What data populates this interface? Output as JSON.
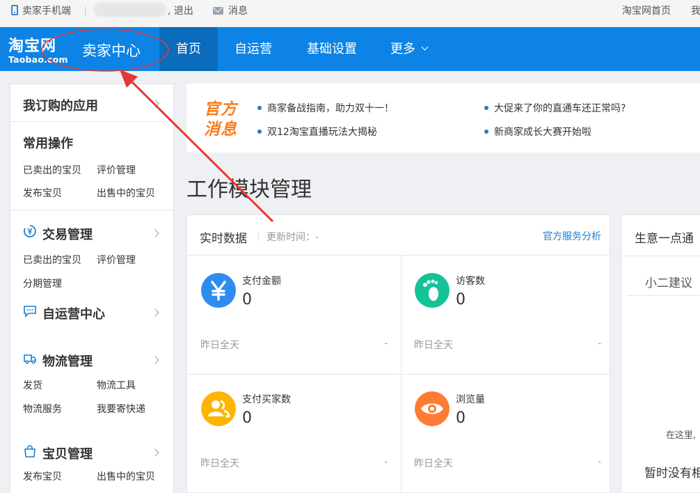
{
  "topbar": {
    "mobile": "卖家手机端",
    "logout": ", 退出",
    "messages": "消息",
    "home": "淘宝网首页",
    "my": "我"
  },
  "nav": {
    "logo_cn": "淘宝网",
    "logo_en": "Taobao.com",
    "seller_center": "卖家中心",
    "tabs": [
      {
        "label": "首页"
      },
      {
        "label": "自运营"
      },
      {
        "label": "基础设置"
      },
      {
        "label": "更多"
      }
    ],
    "brand_color": "#0d84e5"
  },
  "sidebar": {
    "subscribed": "我订购的应用",
    "common": {
      "title": "常用操作",
      "links": [
        "已卖出的宝贝",
        "评价管理",
        "发布宝贝",
        "出售中的宝贝"
      ]
    },
    "trade": {
      "title": "交易管理",
      "links": [
        "已卖出的宝贝",
        "评价管理",
        "分期管理"
      ]
    },
    "selfop": {
      "title": "自运营中心"
    },
    "logistics": {
      "title": "物流管理",
      "links": [
        "发货",
        "物流工具",
        "物流服务",
        "我要寄快递"
      ]
    },
    "goods": {
      "title": "宝贝管理",
      "links": [
        "发布宝贝",
        "出售中的宝贝"
      ]
    }
  },
  "notice": {
    "label_line1": "官方",
    "label_line2": "消息",
    "items": [
      "商家备战指南，助力双十一！",
      "大促来了你的直通车还正常吗?",
      "双12淘宝直播玩法大揭秘",
      "新商家成长大赛开始啦"
    ]
  },
  "module_title": "工作模块管理",
  "realtime": {
    "title": "实时数据",
    "updated": "更新时间：-",
    "service_link": "官方服务分析",
    "metrics": [
      {
        "label": "支付金额",
        "value": "0",
        "yesterday": "昨日全天",
        "delta": "-",
        "icon": "yen-icon",
        "color": "#2d8cf0"
      },
      {
        "label": "访客数",
        "value": "0",
        "yesterday": "昨日全天",
        "delta": "-",
        "icon": "footprint-icon",
        "color": "#15c39a"
      },
      {
        "label": "支付买家数",
        "value": "0",
        "yesterday": "昨日全天",
        "delta": "-",
        "icon": "buyers-icon",
        "color": "#ffb400"
      },
      {
        "label": "浏览量",
        "value": "0",
        "yesterday": "昨日全天",
        "delta": "-",
        "icon": "eye-icon",
        "color": "#ff7a32"
      }
    ]
  },
  "business": {
    "title": "生意一点通",
    "tab": "小二建议",
    "hint": "在这里,",
    "empty": "暂时没有相"
  }
}
